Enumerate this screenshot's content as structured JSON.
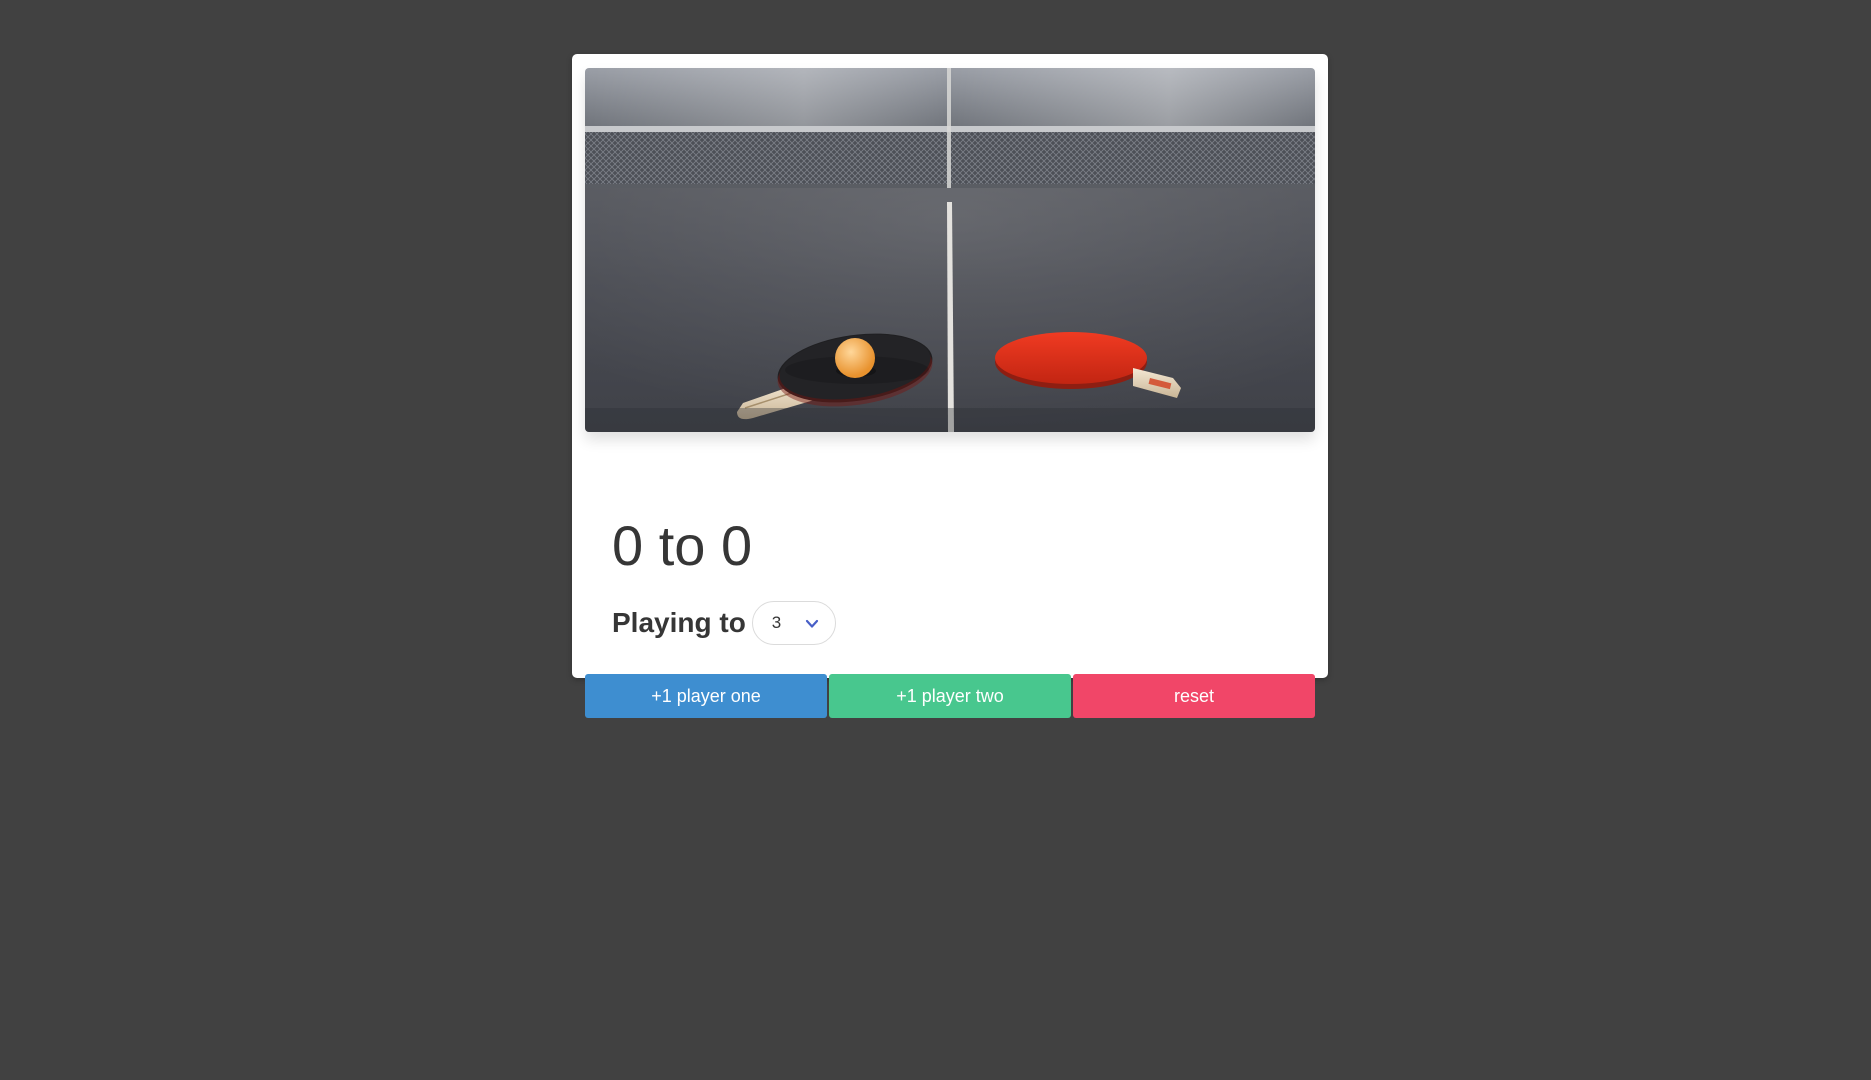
{
  "score": {
    "player_one": "0",
    "separator": "to",
    "player_two": "0"
  },
  "playing_to": {
    "label": "Playing to",
    "selected": "3"
  },
  "buttons": {
    "player_one": "+1 player one",
    "player_two": "+1 player two",
    "reset": "reset"
  },
  "colors": {
    "background": "#414141",
    "player_one": "#3e8ed0",
    "player_two": "#48c78e",
    "reset": "#f14668"
  },
  "image": {
    "subject": "ping-pong paddles and ball on table"
  }
}
